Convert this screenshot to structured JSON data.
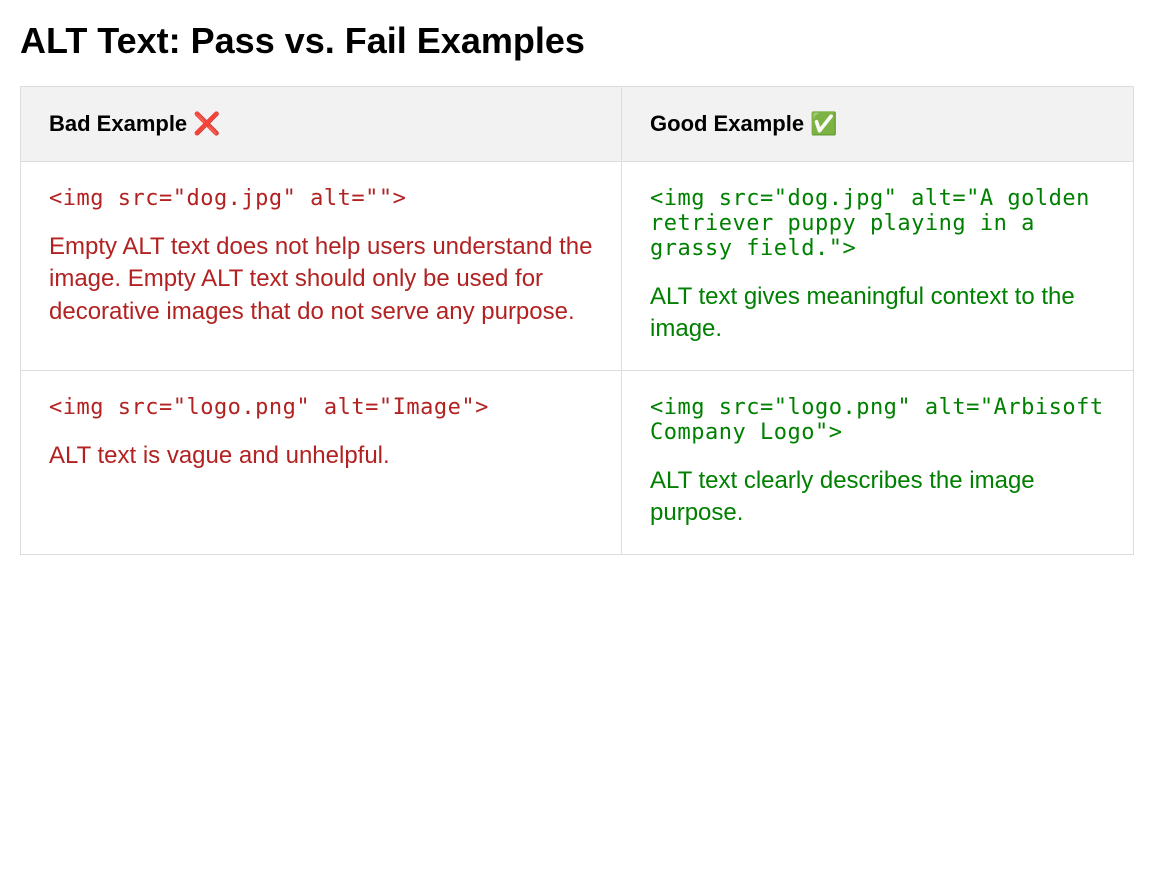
{
  "title": "ALT Text: Pass vs. Fail Examples",
  "headers": {
    "bad": "Bad Example ❌",
    "good": "Good Example ✅"
  },
  "rows": [
    {
      "bad": {
        "code": "<img src=\"dog.jpg\" alt=\"\">",
        "explanation": "Empty ALT text does not help users understand the image. Empty ALT text should only be used for decorative images that do not serve any purpose."
      },
      "good": {
        "code": "<img src=\"dog.jpg\" alt=\"A golden retriever puppy playing in a grassy field.\">",
        "explanation": "ALT text gives meaningful context to the image."
      }
    },
    {
      "bad": {
        "code": "<img src=\"logo.png\" alt=\"Image\">",
        "explanation": "ALT text is vague and unhelpful."
      },
      "good": {
        "code": "<img src=\"logo.png\" alt=\"Arbisoft Company Logo\">",
        "explanation": "ALT text clearly describes the image purpose."
      }
    }
  ]
}
